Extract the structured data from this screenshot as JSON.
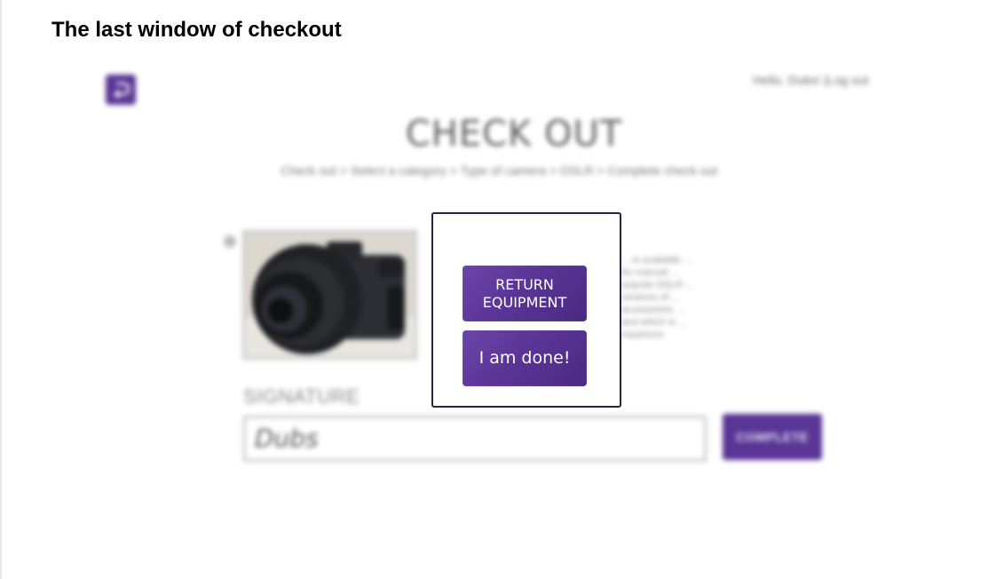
{
  "slide_title": "The last window of checkout",
  "header": {
    "greeting": "Hello, Dubs!",
    "separator": "|",
    "logout_label": "Log out"
  },
  "page": {
    "title": "CHECK OUT",
    "breadcrumb": "Check out > Select a category > Type of camera > DSLR > Complete check out"
  },
  "item": {
    "description": "... is available ... for manual ... popular DSLR ... versions of ... accessories ... and which is ... maximum"
  },
  "signature": {
    "label": "SIGNATURE",
    "value": "Dubs"
  },
  "complete_label": "COMPLETE",
  "modal": {
    "return_line1": "RETURN",
    "return_line2": "EQUIPMENT",
    "done_label": "I am done!"
  },
  "colors": {
    "brand_purple": "#5a3596"
  },
  "icons": {
    "back": "return-arrow-icon"
  }
}
